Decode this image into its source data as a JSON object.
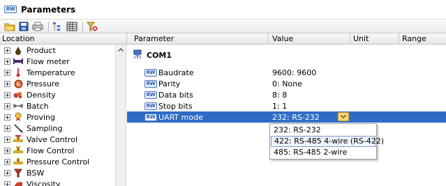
{
  "window": {
    "badge": "RW",
    "title": "Parameters"
  },
  "toolbar": {
    "buttons": [
      "open-folder-icon",
      "save-icon",
      "print-icon",
      "tree-view-icon",
      "table-view-icon",
      "filter-clear-icon"
    ]
  },
  "columns": {
    "location": "Location",
    "parameter": "Parameter",
    "value": "Value",
    "unit": "Unit",
    "range": "Range"
  },
  "locations": [
    {
      "label": "Product",
      "icon": "product-drop-icon"
    },
    {
      "label": "Flow meter",
      "icon": "flow-meter-icon"
    },
    {
      "label": "Temperature",
      "icon": "thermometer-icon"
    },
    {
      "label": "Pressure",
      "icon": "pressure-gauge-icon"
    },
    {
      "label": "Density",
      "icon": "density-icon"
    },
    {
      "label": "Batch",
      "icon": "batch-icon"
    },
    {
      "label": "Proving",
      "icon": "proving-icon"
    },
    {
      "label": "Sampling",
      "icon": "sampling-icon"
    },
    {
      "label": "Valve Control",
      "icon": "valve-icon"
    },
    {
      "label": "Flow Control",
      "icon": "flow-control-icon"
    },
    {
      "label": "Pressure Control",
      "icon": "pressure-control-icon"
    },
    {
      "label": "BSW",
      "icon": "bsw-funnel-icon"
    },
    {
      "label": "Viscosity",
      "icon": "viscosity-icon"
    }
  ],
  "group": {
    "label": "COM1",
    "icon": "serial-port-icon"
  },
  "parameters": [
    {
      "badge": "RW",
      "name": "Baudrate",
      "value": "9600: 9600"
    },
    {
      "badge": "RW",
      "name": "Parity",
      "value": "0: None"
    },
    {
      "badge": "RW",
      "name": "Data bits",
      "value": "8: 8"
    },
    {
      "badge": "RW",
      "name": "Stop bits",
      "value": "1: 1"
    },
    {
      "badge": "RW",
      "name": "UART mode",
      "value": "232: RS-232"
    }
  ],
  "dropdown": {
    "options": [
      "232: RS-232",
      "422: RS-485 4-wire (RS-422)",
      "485: RS-485 2-wire"
    ],
    "highlighted_index": 1
  },
  "colors": {
    "selection": "#2f6cc6",
    "dropdown_button": "#f7d57a"
  }
}
